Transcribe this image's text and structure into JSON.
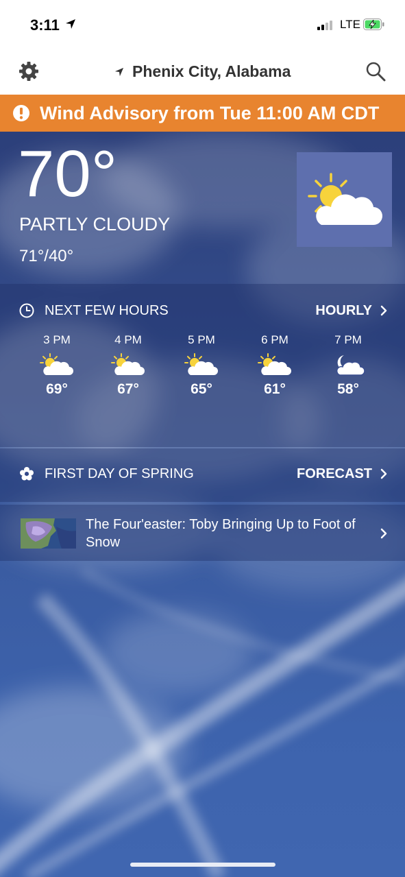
{
  "status_bar": {
    "time": "3:11",
    "network": "LTE",
    "icons": [
      "location-arrow-icon",
      "signal-icon",
      "battery-charging-icon"
    ]
  },
  "header": {
    "location": "Phenix City, Alabama",
    "icons": [
      "gear-icon",
      "location-arrow-icon",
      "search-icon"
    ]
  },
  "alert": {
    "text": "Wind Advisory from Tue 11:00 AM CDT",
    "color": "#e8842f",
    "icon": "alert-icon"
  },
  "current": {
    "temperature": "70°",
    "condition": "PARTLY CLOUDY",
    "hi_lo": "71°/40°",
    "icon": "partly-cloudy-icon"
  },
  "hourly": {
    "title": "NEXT FEW HOURS",
    "link": "HOURLY",
    "icon": "clock-icon",
    "hours": [
      {
        "time": "3 PM",
        "temp": "69°",
        "icon": "partly-cloudy-icon"
      },
      {
        "time": "4 PM",
        "temp": "67°",
        "icon": "partly-cloudy-icon"
      },
      {
        "time": "5 PM",
        "temp": "65°",
        "icon": "partly-cloudy-icon"
      },
      {
        "time": "6 PM",
        "temp": "61°",
        "icon": "partly-cloudy-icon"
      },
      {
        "time": "7 PM",
        "temp": "58°",
        "icon": "partly-cloudy-night-icon"
      }
    ]
  },
  "spring": {
    "title": "FIRST DAY OF SPRING",
    "link": "FORECAST",
    "icon": "flower-icon"
  },
  "news": {
    "title": "The Four'easter: Toby Bringing Up to Foot of Snow",
    "thumbnail": "weather-map-thumbnail"
  },
  "colors": {
    "alert_orange": "#e8842f",
    "icon_box": "#5e6fae",
    "sun_yellow": "#f7d33c"
  }
}
